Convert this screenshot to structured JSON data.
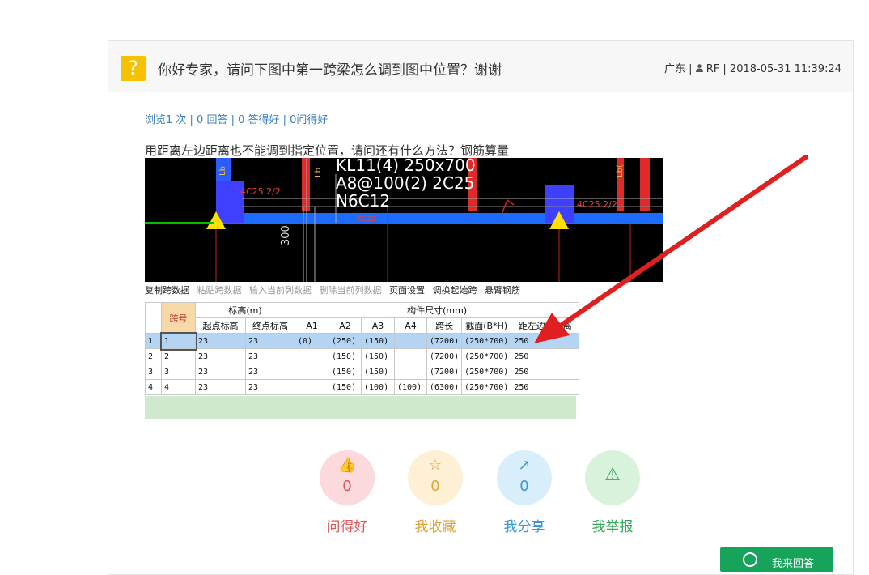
{
  "question": {
    "icon": "question-mark-icon",
    "icon_glyph": "?",
    "title": "你好专家，请问下图中第一跨梁怎么调到图中位置？谢谢",
    "region": "广东",
    "user": "RF",
    "datetime": "2018-05-31 11:39:24"
  },
  "stats": {
    "text": "浏览1 次 | 0 回答 | 0 答得好 | 0问得好"
  },
  "body": "用距离左边距离也不能调到指定位置，请问还有什么方法？钢筋算量",
  "screenshot": {
    "cad_text": {
      "line1": "KL11(4) 250x700",
      "line2": "A8@100(2) 2C25",
      "line3": "N6C12",
      "left_label": "4C25 2/2",
      "right_label": "4C25 2/2",
      "dim_300": "300",
      "lb1": "Lb",
      "lb2": "Lb",
      "lb3": "Lb(",
      "mid_label": "3C22"
    },
    "toolbar": [
      "复制跨数据",
      "粘贴跨数据",
      "输入当前列数据",
      "删除当前列数据",
      "页面设置",
      "调换起始跨",
      "悬臂钢筋"
    ],
    "table": {
      "group_headers": {
        "span": "跨号",
        "elev": "标高(m)",
        "dims": "构件尺寸(mm)"
      },
      "sub_headers": [
        "起点标高",
        "终点标高",
        "A1",
        "A2",
        "A3",
        "A4",
        "跨长",
        "截面(B*H)",
        "距左边线距离"
      ],
      "rows": [
        [
          "1",
          "1",
          "23",
          "23",
          "(0)",
          "(250)",
          "(150)",
          "",
          "(7200)",
          "(250*700)",
          "250"
        ],
        [
          "2",
          "2",
          "23",
          "23",
          "",
          "(150)",
          "(150)",
          "",
          "(7200)",
          "(250*700)",
          "250"
        ],
        [
          "3",
          "3",
          "23",
          "23",
          "",
          "(150)",
          "(150)",
          "",
          "(7200)",
          "(250*700)",
          "250"
        ],
        [
          "4",
          "4",
          "23",
          "23",
          "",
          "(150)",
          "(100)",
          "(100)",
          "(6300)",
          "(250*700)",
          "250"
        ]
      ]
    }
  },
  "actions": [
    {
      "icon": "thumbs-up-icon",
      "glyph": "👍",
      "count": "0",
      "label": "问得好",
      "color": "#e0565a",
      "bg": "#fbd9dc"
    },
    {
      "icon": "star-icon",
      "glyph": "☆",
      "count": "0",
      "label": "我收藏",
      "color": "#e0a23a",
      "bg": "#fdf0d4"
    },
    {
      "icon": "share-icon",
      "glyph": "↗",
      "count": "0",
      "label": "我分享",
      "color": "#3a98d8",
      "bg": "#d8eefb"
    },
    {
      "icon": "warning-icon",
      "glyph": "⚠",
      "count": "",
      "label": "我举报",
      "color": "#3aa85a",
      "bg": "#d8f2dc"
    }
  ],
  "answer_button": {
    "label": "我来回答",
    "icon": "chat-bubble-icon"
  },
  "colors": {
    "accent_green": "#18a35a",
    "link_blue": "#3a7fc1",
    "arrow_red": "#e02020"
  }
}
